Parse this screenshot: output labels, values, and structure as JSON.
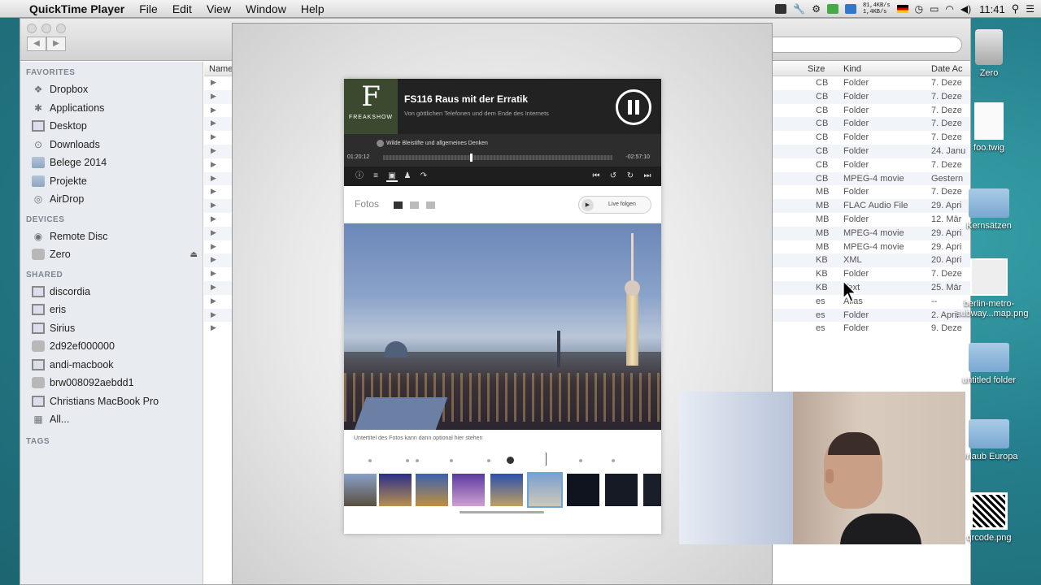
{
  "menubar": {
    "app_name": "QuickTime Player",
    "items": [
      "File",
      "Edit",
      "View",
      "Window",
      "Help"
    ],
    "net_up": "81,4KB/s",
    "net_down": "1,4KB/s",
    "clock": "11:41"
  },
  "finder": {
    "sidebar": {
      "favorites_head": "FAVORITES",
      "favorites": [
        {
          "label": "Dropbox",
          "icon": "dropbox-icon"
        },
        {
          "label": "Applications",
          "icon": "applications-icon"
        },
        {
          "label": "Desktop",
          "icon": "desktop-icon"
        },
        {
          "label": "Downloads",
          "icon": "downloads-icon"
        },
        {
          "label": "Belege 2014",
          "icon": "folder-icon"
        },
        {
          "label": "Projekte",
          "icon": "folder-icon"
        },
        {
          "label": "AirDrop",
          "icon": "airdrop-icon"
        }
      ],
      "devices_head": "DEVICES",
      "devices": [
        {
          "label": "Remote Disc",
          "icon": "disc-icon"
        },
        {
          "label": "Zero",
          "icon": "disk-icon"
        }
      ],
      "shared_head": "SHARED",
      "shared": [
        {
          "label": "discordia"
        },
        {
          "label": "eris"
        },
        {
          "label": "Sirius"
        },
        {
          "label": "2d92ef000000"
        },
        {
          "label": "andi-macbook"
        },
        {
          "label": "brw008092aebdd1"
        },
        {
          "label": "Christians MacBook Pro"
        },
        {
          "label": "All..."
        }
      ],
      "tags_head": "TAGS"
    },
    "columns": {
      "name": "Name",
      "size": "Size",
      "kind": "Kind",
      "date": "Date Ac"
    },
    "rows": [
      {
        "size": "CB",
        "kind": "Folder",
        "date": "7. Deze"
      },
      {
        "size": "CB",
        "kind": "Folder",
        "date": "7. Deze"
      },
      {
        "size": "CB",
        "kind": "Folder",
        "date": "7. Deze"
      },
      {
        "size": "CB",
        "kind": "Folder",
        "date": "7. Deze"
      },
      {
        "size": "CB",
        "kind": "Folder",
        "date": "7. Deze"
      },
      {
        "size": "CB",
        "kind": "Folder",
        "date": "24. Janu"
      },
      {
        "size": "CB",
        "kind": "Folder",
        "date": "7. Deze"
      },
      {
        "size": "CB",
        "kind": "MPEG-4 movie",
        "date": "Gestern"
      },
      {
        "size": "MB",
        "kind": "Folder",
        "date": "7. Deze"
      },
      {
        "size": "MB",
        "kind": "FLAC Audio File",
        "date": "29. Apri"
      },
      {
        "size": "MB",
        "kind": "Folder",
        "date": "12. Mär"
      },
      {
        "size": "MB",
        "kind": "MPEG-4 movie",
        "date": "29. Apri"
      },
      {
        "size": "MB",
        "kind": "MPEG-4 movie",
        "date": "29. Apri"
      },
      {
        "size": "KB",
        "kind": "XML",
        "date": "20. Apri"
      },
      {
        "size": "KB",
        "kind": "Folder",
        "date": "7. Deze"
      },
      {
        "size": "KB",
        "kind": "Text",
        "date": "25. Mär"
      },
      {
        "size": "es",
        "kind": "Alias",
        "date": "--"
      },
      {
        "size": "es",
        "kind": "Folder",
        "date": "2. April"
      },
      {
        "size": "es",
        "kind": "Folder",
        "date": "9. Deze"
      }
    ]
  },
  "app": {
    "logo_glyph": "F",
    "logo_text": "FREAKSHOW",
    "episode_title": "FS116 Raus mit der Erratik",
    "episode_subtitle": "Von göttlichen Telefonen und dem Ende des Internets",
    "chapter": "Wilde Bleistifte und allgemeines Denken",
    "time_elapsed": "01:20:12",
    "time_remaining": "-02:57:10",
    "progress": 0.38,
    "fotos_label": "Fotos",
    "live_label": "Live folgen",
    "caption": "Untertitel des Fotos kann dann optional hier stehen"
  },
  "desktop_icons": [
    {
      "label": "Zero"
    },
    {
      "label": "foo.twig"
    },
    {
      "label": "Kernsätzen"
    },
    {
      "label": "berlin-metro-subway...map.png"
    },
    {
      "label": "untitled folder"
    },
    {
      "label": "Urlaub Europa"
    },
    {
      "label": "qrcode.png"
    }
  ]
}
